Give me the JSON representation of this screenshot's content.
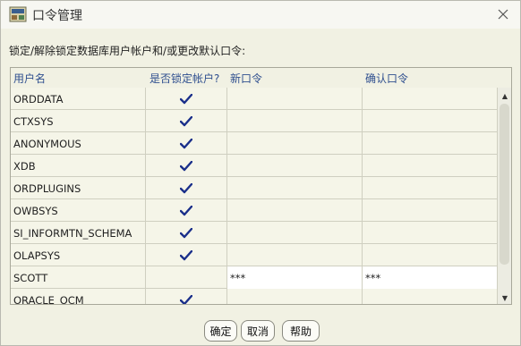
{
  "window": {
    "title": "口令管理",
    "app_icon": "database-icon",
    "close_icon": "close-icon"
  },
  "instruction": "锁定/解除锁定数据库用户帐户和/或更改默认口令:",
  "table": {
    "headers": [
      "用户名",
      "是否锁定帐户?",
      "新口令",
      "确认口令"
    ],
    "rows": [
      {
        "user": "ORDDATA",
        "locked": true,
        "new_password": "",
        "confirm_password": ""
      },
      {
        "user": "CTXSYS",
        "locked": true,
        "new_password": "",
        "confirm_password": ""
      },
      {
        "user": "ANONYMOUS",
        "locked": true,
        "new_password": "",
        "confirm_password": ""
      },
      {
        "user": "XDB",
        "locked": true,
        "new_password": "",
        "confirm_password": ""
      },
      {
        "user": "ORDPLUGINS",
        "locked": true,
        "new_password": "",
        "confirm_password": ""
      },
      {
        "user": "OWBSYS",
        "locked": true,
        "new_password": "",
        "confirm_password": ""
      },
      {
        "user": "SI_INFORMTN_SCHEMA",
        "locked": true,
        "new_password": "",
        "confirm_password": ""
      },
      {
        "user": "OLAPSYS",
        "locked": true,
        "new_password": "",
        "confirm_password": ""
      },
      {
        "user": "SCOTT",
        "locked": false,
        "new_password": "***",
        "confirm_password": "***"
      },
      {
        "user": "ORACLE_OCM",
        "locked": true,
        "new_password": "",
        "confirm_password": ""
      }
    ]
  },
  "buttons": {
    "ok": "确定",
    "cancel": "取消",
    "help": "帮助"
  },
  "colors": {
    "header_text": "#2f4f8f",
    "check": "#1a2f8a",
    "background": "#f1f1e3"
  }
}
